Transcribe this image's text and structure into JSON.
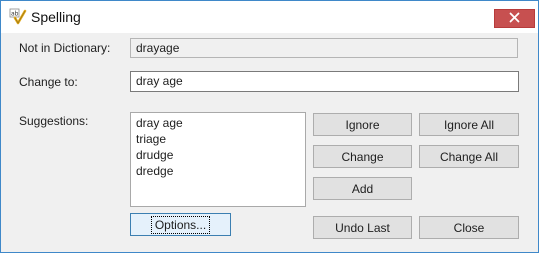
{
  "window": {
    "title": "Spelling",
    "icon": "spellcheck-icon",
    "close_icon": "close-icon",
    "accent_color": "#3f88c9",
    "close_color": "#c75050"
  },
  "labels": {
    "not_in_dictionary": "Not in Dictionary:",
    "change_to": "Change to:",
    "suggestions": "Suggestions:"
  },
  "fields": {
    "not_in_dictionary_value": "drayage",
    "change_to_value": "dray age"
  },
  "suggestions": [
    "dray age",
    "triage",
    "drudge",
    "dredge"
  ],
  "buttons": {
    "ignore": "Ignore",
    "ignore_all": "Ignore All",
    "change": "Change",
    "change_all": "Change All",
    "add": "Add",
    "options": "Options...",
    "undo_last": "Undo Last",
    "close": "Close"
  }
}
